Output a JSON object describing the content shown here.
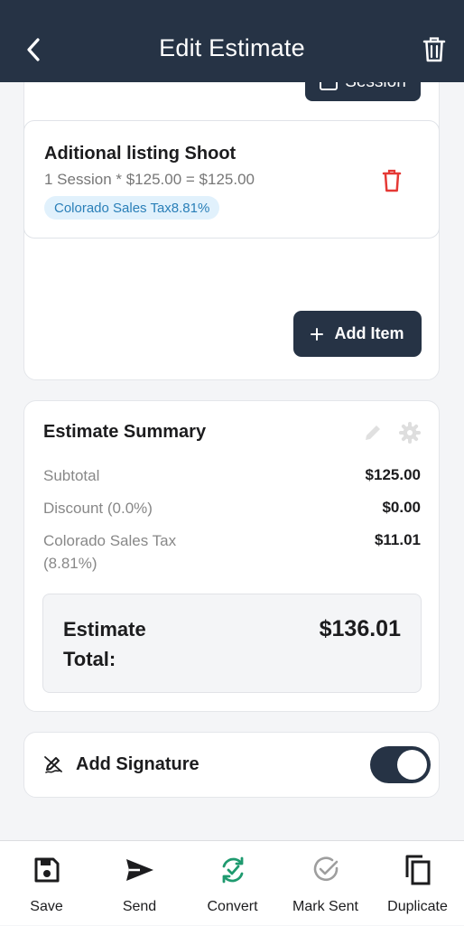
{
  "header": {
    "title": "Edit Estimate",
    "back_icon": "chevron-left-icon",
    "delete_icon": "trash-icon"
  },
  "session_button": {
    "label": "Session"
  },
  "line_item": {
    "title": "Aditional listing Shoot",
    "detail": "1 Session * $125.00 = $125.00",
    "tax_badge": "Colorado Sales Tax8.81%"
  },
  "add_item": {
    "label": "Add Item",
    "icon": "plus-icon"
  },
  "summary": {
    "title": "Estimate Summary",
    "rows": [
      {
        "label": "Subtotal",
        "value": "$125.00"
      },
      {
        "label": "Discount (0.0%)",
        "value": "$0.00"
      },
      {
        "label": "Colorado Sales Tax (8.81%)",
        "value": "$11.01"
      }
    ],
    "total_label": "Estimate Total:",
    "total_value": "$136.01"
  },
  "signature": {
    "label": "Add Signature",
    "enabled": true
  },
  "bottom_bar": [
    {
      "label": "Save",
      "icon": "save-icon"
    },
    {
      "label": "Send",
      "icon": "send-icon"
    },
    {
      "label": "Convert",
      "icon": "convert-icon"
    },
    {
      "label": "Mark Sent",
      "icon": "check-circle-icon"
    },
    {
      "label": "Duplicate",
      "icon": "copy-icon"
    }
  ],
  "colors": {
    "primary": "#263345",
    "danger": "#e53935",
    "convert": "#1f9a6f",
    "badge_bg": "#e1f1fc",
    "badge_text": "#2a7fb8"
  }
}
